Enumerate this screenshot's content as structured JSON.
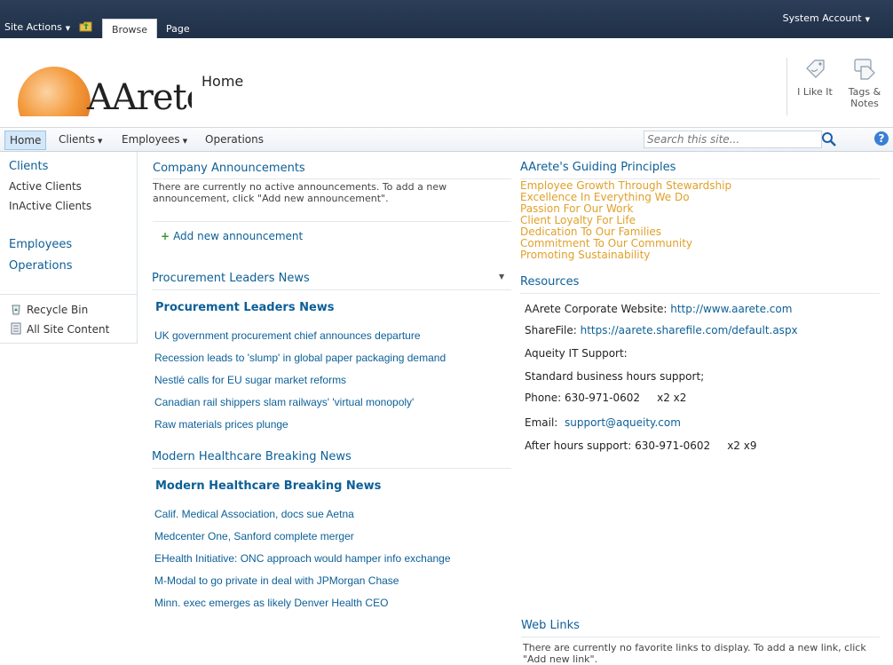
{
  "ribbon": {
    "site_actions": "Site Actions",
    "tabs": [
      {
        "label": "Browse"
      },
      {
        "label": "Page"
      }
    ],
    "account": "System Account"
  },
  "header": {
    "logo_text": "AArete",
    "page_title": "Home",
    "i_like_it": "I Like It",
    "tags_notes_1": "Tags &",
    "tags_notes_2": "Notes"
  },
  "topnav": {
    "items": [
      {
        "label": "Home"
      },
      {
        "label": "Clients"
      },
      {
        "label": "Employees"
      },
      {
        "label": "Operations"
      }
    ],
    "search_placeholder": "Search this site..."
  },
  "leftnav": {
    "clients": "Clients",
    "active_clients": "Active Clients",
    "inactive_clients": "InActive Clients",
    "employees": "Employees",
    "operations": "Operations",
    "recycle_bin": "Recycle Bin",
    "all_site_content": "All Site Content"
  },
  "announcements": {
    "title": "Company Announcements",
    "empty": "There are currently no active announcements. To add a new announcement, click \"Add new announcement\".",
    "add": "Add new announcement"
  },
  "procurement": {
    "title": "Procurement Leaders News",
    "feed_title": "Procurement Leaders News",
    "items": [
      "UK government procurement chief announces departure",
      "Recession leads to 'slump' in global paper packaging demand",
      "Nestlé calls for EU sugar market reforms",
      "Canadian rail shippers slam railways' 'virtual monopoly'",
      "Raw materials prices plunge"
    ]
  },
  "healthcare": {
    "title": "Modern Healthcare Breaking News",
    "feed_title": "Modern Healthcare Breaking News",
    "items": [
      "Calif. Medical Association, docs sue Aetna",
      "Medcenter One, Sanford complete merger",
      "EHealth Initiative: ONC approach would hamper info exchange",
      "M-Modal to go private in deal with JPMorgan Chase",
      "Minn. exec emerges as likely Denver Health CEO"
    ]
  },
  "principles": {
    "title": "AArete's Guiding Principles",
    "items": [
      "Employee Growth Through Stewardship",
      "Excellence In Everything We Do",
      "Passion For Our Work",
      "Client Loyalty For Life",
      "Dedication To Our Families",
      "Commitment To Our Community",
      "Promoting Sustainability"
    ]
  },
  "resources": {
    "title": "Resources",
    "corporate_label": "AArete Corporate Website:",
    "corporate_url": "http://www.aarete.com",
    "sharefile_label": "ShareFile:",
    "sharefile_url": "https://aarete.sharefile.com/default.aspx",
    "it_support": "Aqueity IT Support:",
    "hours": "Standard business hours support;",
    "phone": "Phone: 630-971-0602     x2 x2",
    "email_label": "Email:",
    "email": "support@aqueity.com",
    "after_hours": "After hours support: 630-971-0602     x2 x9"
  },
  "weblinks": {
    "title": "Web Links",
    "empty": "There are currently no favorite links to display. To add a new link, click \"Add new link\"."
  },
  "colors": {
    "ribbon": "#1f2f47",
    "link": "#0c5f97",
    "principle": "#e0a02a",
    "logo_orange": "#f39a3d"
  }
}
